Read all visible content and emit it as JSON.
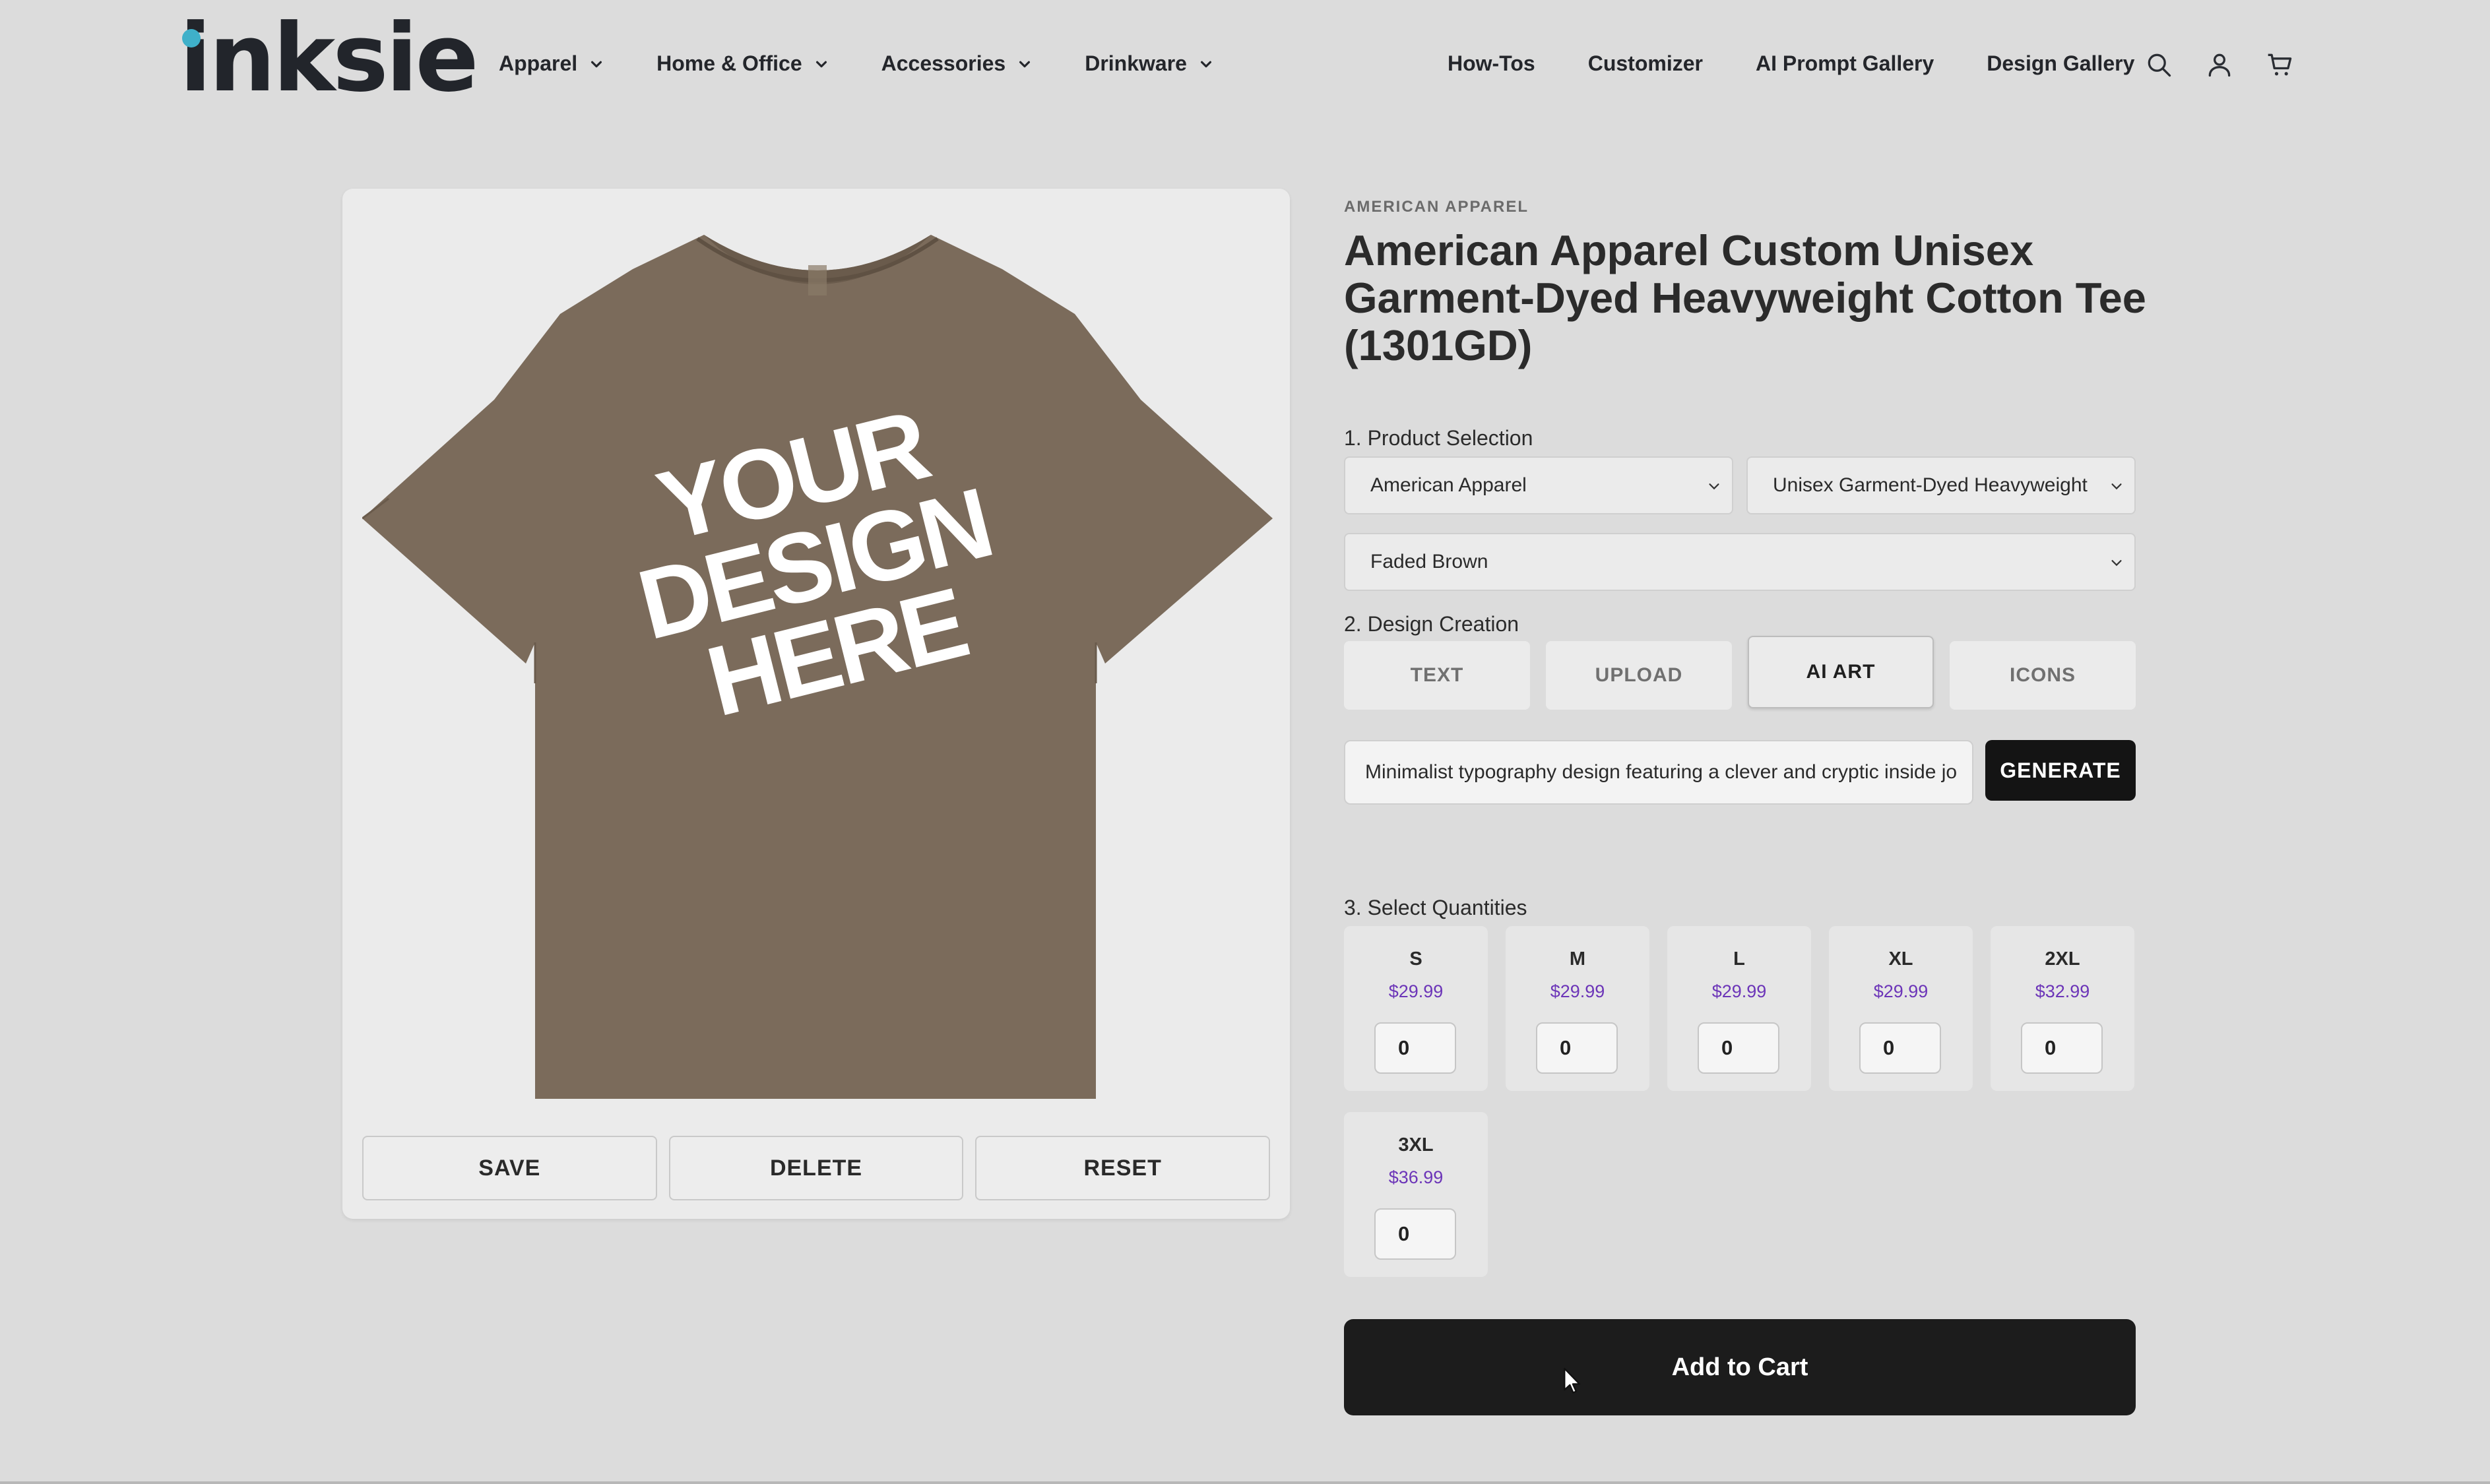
{
  "header": {
    "logo": "inksie",
    "nav_left": [
      {
        "label": "Apparel"
      },
      {
        "label": "Home & Office"
      },
      {
        "label": "Accessories"
      },
      {
        "label": "Drinkware"
      }
    ],
    "nav_right": [
      {
        "label": "How-Tos"
      },
      {
        "label": "Customizer"
      },
      {
        "label": "AI Prompt Gallery"
      },
      {
        "label": "Design Gallery"
      }
    ],
    "icons": [
      "search-icon",
      "account-icon",
      "cart-icon"
    ]
  },
  "preview": {
    "design_text": [
      "YOUR",
      "DESIGN",
      "HERE"
    ],
    "shirt_color": "#7b6b5b",
    "actions": {
      "save": "SAVE",
      "delete": "DELETE",
      "reset": "RESET"
    }
  },
  "product": {
    "brand": "AMERICAN APPAREL",
    "title": "American Apparel Custom Unisex Garment-Dyed Heavyweight Cotton Tee (1301GD)"
  },
  "selection": {
    "label": "1. Product Selection",
    "brand_value": "American Apparel",
    "style_value": "Unisex Garment-Dyed Heavyweight",
    "color_value": "Faded Brown"
  },
  "design": {
    "label": "2. Design Creation",
    "tabs": [
      {
        "label": "TEXT"
      },
      {
        "label": "UPLOAD"
      },
      {
        "label": "AI ART",
        "active": true
      },
      {
        "label": "ICONS"
      }
    ],
    "prompt_value": "Minimalist typography design featuring a clever and cryptic inside jo",
    "generate_label": "GENERATE"
  },
  "quantities": {
    "label": "3. Select Quantities",
    "sizes": [
      {
        "size": "S",
        "price": "$29.99",
        "qty": "0"
      },
      {
        "size": "M",
        "price": "$29.99",
        "qty": "0"
      },
      {
        "size": "L",
        "price": "$29.99",
        "qty": "0"
      },
      {
        "size": "XL",
        "price": "$29.99",
        "qty": "0"
      },
      {
        "size": "2XL",
        "price": "$32.99",
        "qty": "0"
      },
      {
        "size": "3XL",
        "price": "$36.99",
        "qty": "0"
      }
    ]
  },
  "cart": {
    "label": "Add to Cart"
  },
  "colors": {
    "accent_price": "#6c35b8",
    "logo_dot": "#3fb0c9",
    "dark_button": "#1c1c1c"
  }
}
